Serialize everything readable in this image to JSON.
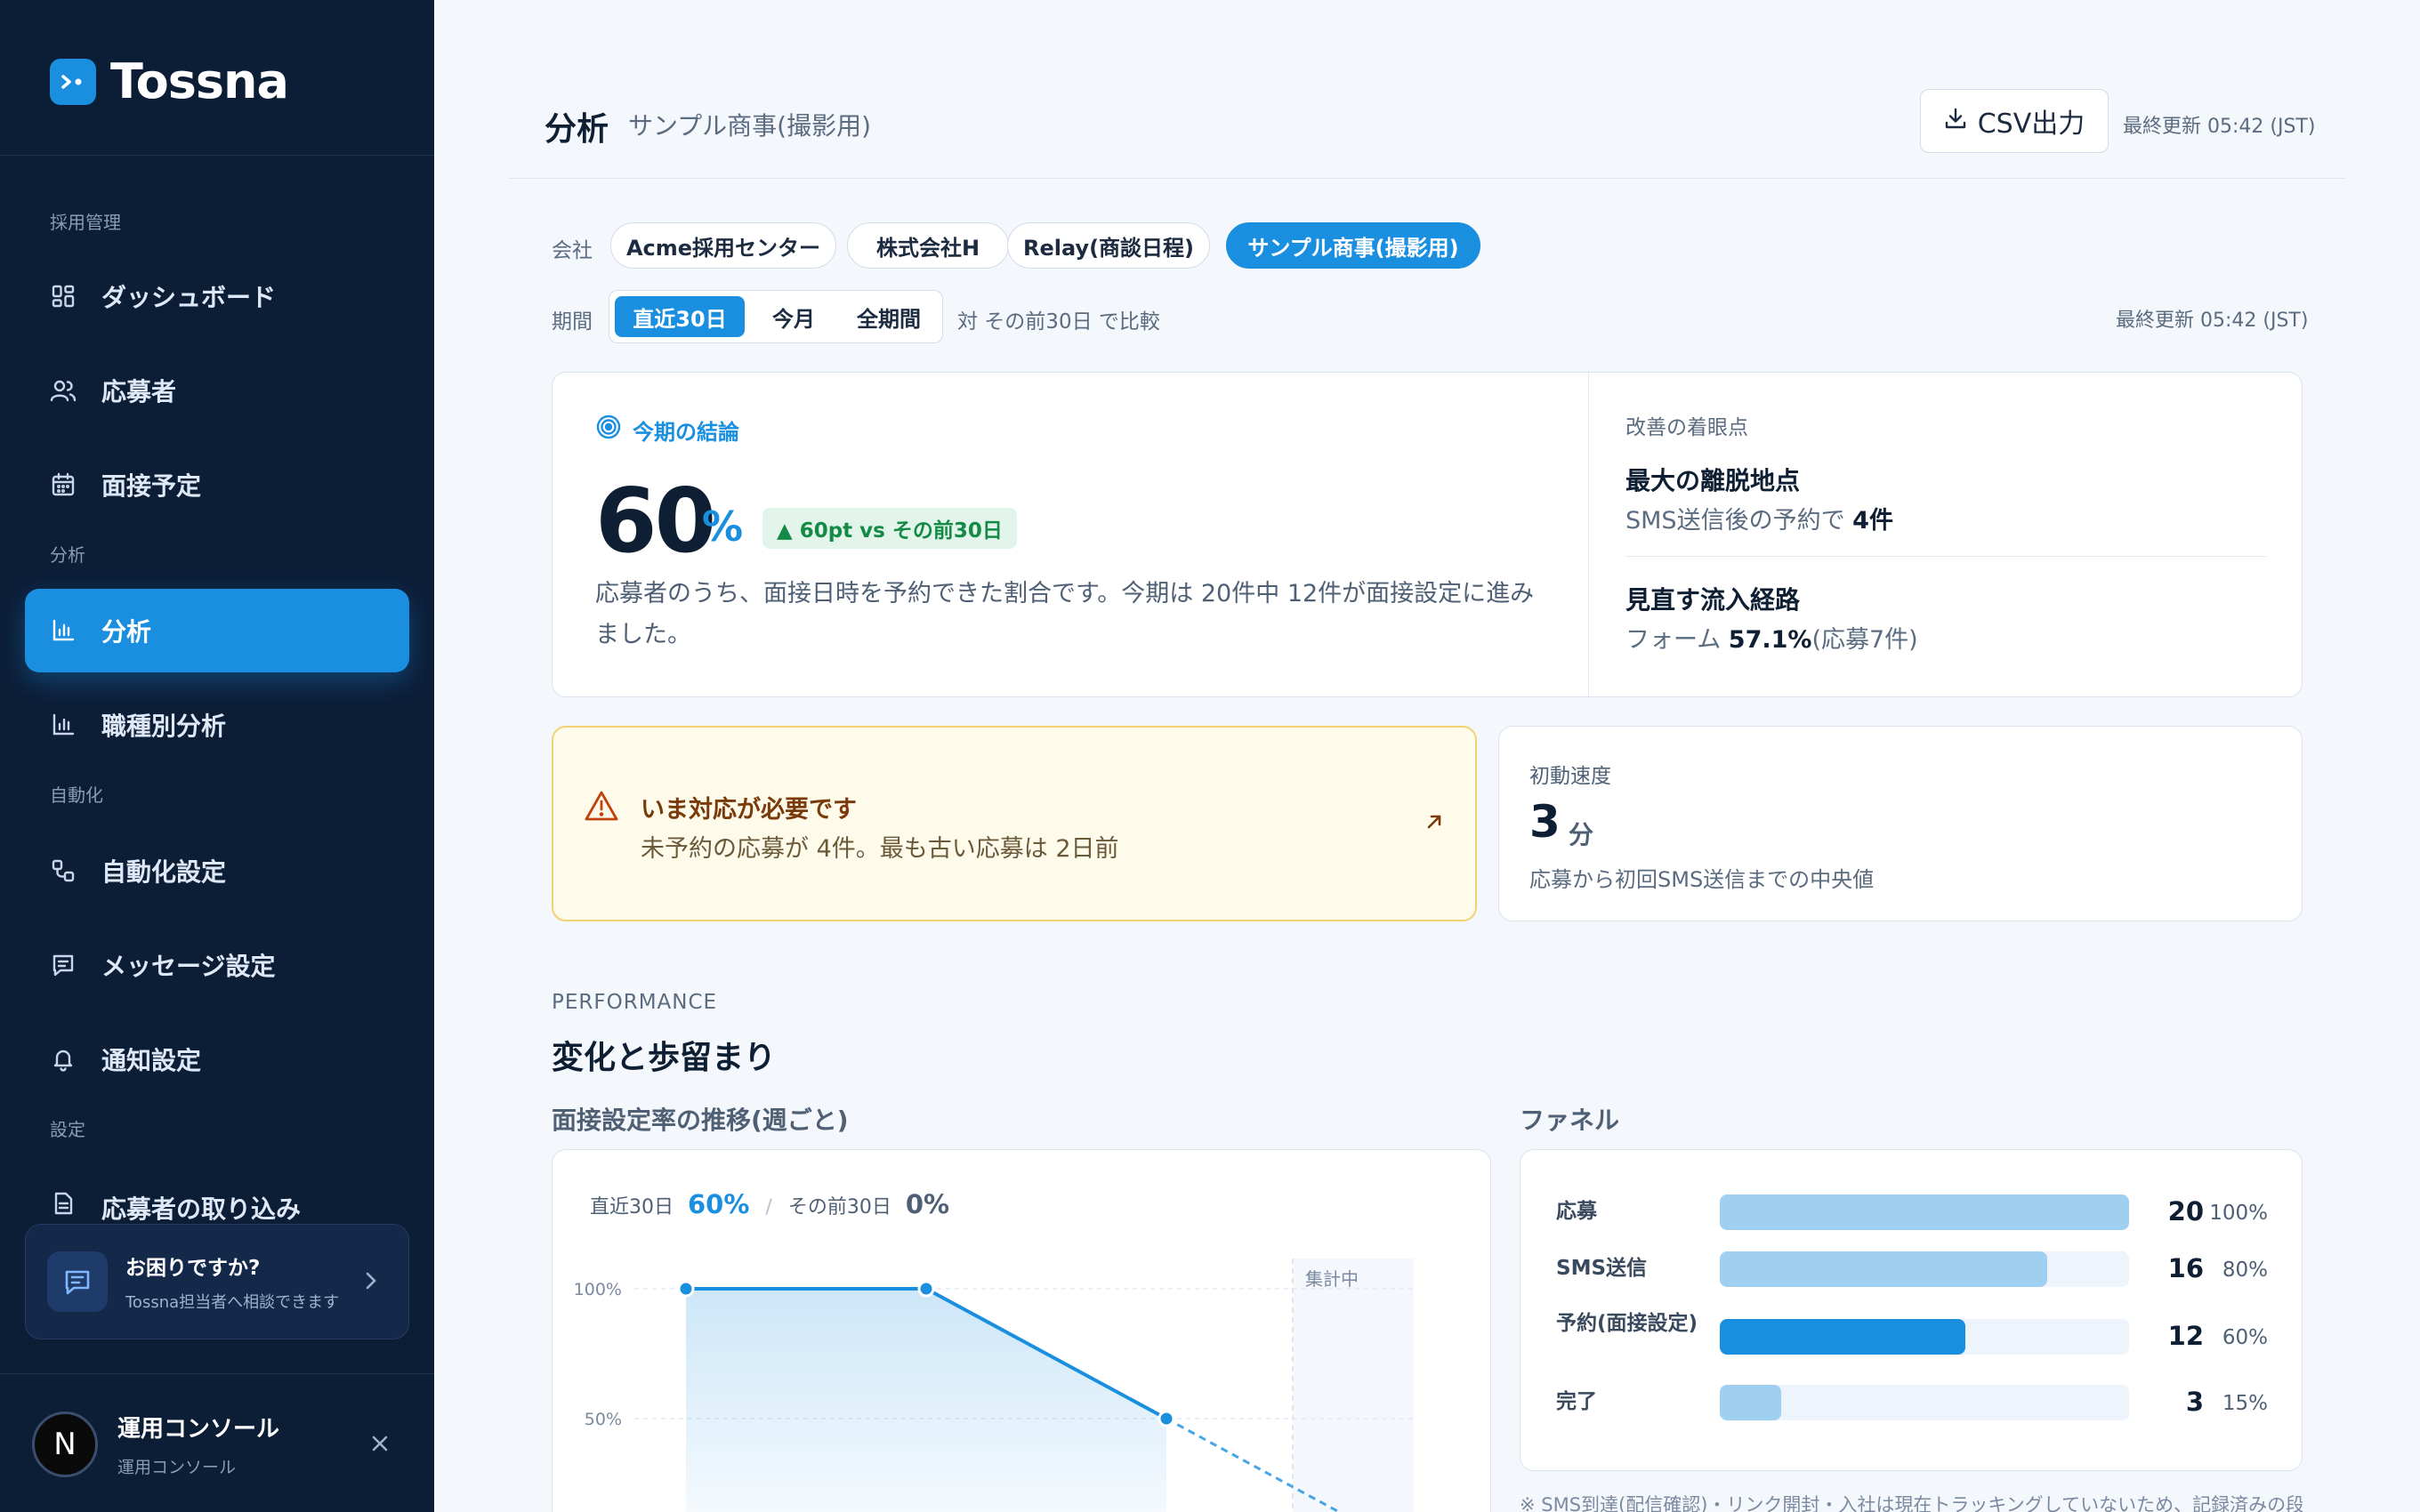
{
  "brand": {
    "name": "Tossna"
  },
  "sidebar": {
    "sections": [
      {
        "label": "採用管理",
        "items": [
          {
            "label": "ダッシュボード",
            "icon": "grid-icon"
          },
          {
            "label": "応募者",
            "icon": "users-icon"
          },
          {
            "label": "面接予定",
            "icon": "calendar-icon"
          }
        ]
      },
      {
        "label": "分析",
        "items": [
          {
            "label": "分析",
            "icon": "bar-chart-icon",
            "active": true
          },
          {
            "label": "職種別分析",
            "icon": "bar-chart-icon"
          }
        ]
      },
      {
        "label": "自動化",
        "items": [
          {
            "label": "自動化設定",
            "icon": "workflow-icon"
          },
          {
            "label": "メッセージ設定",
            "icon": "message-icon"
          },
          {
            "label": "通知設定",
            "icon": "bell-icon"
          }
        ]
      },
      {
        "label": "設定",
        "items": [
          {
            "label": "応募者の取り込み",
            "icon": "file-icon"
          }
        ]
      }
    ],
    "help": {
      "title": "お困りですか?",
      "subtitle": "Tossna担当者へ相談できます"
    },
    "user": {
      "initial": "N",
      "name": "運用コンソール",
      "role": "運用コンソール"
    }
  },
  "header": {
    "title": "分析",
    "subtitle": "サンプル商事(撮影用)",
    "csv_label": "CSV出力",
    "updated": "最終更新 05:42 (JST)"
  },
  "filters": {
    "company_label": "会社",
    "companies": [
      "Acme採用センター",
      "株式会社H",
      "Relay(商談日程)",
      "サンプル商事(撮影用)"
    ],
    "selected_company": "サンプル商事(撮影用)",
    "period_label": "期間",
    "periods": [
      "直近30日",
      "今月",
      "全期間"
    ],
    "selected_period": "直近30日",
    "compare_text": "対 その前30日 で比較",
    "updated": "最終更新 05:42 (JST)"
  },
  "kpi": {
    "tag": "今期の結論",
    "value": "60",
    "unit": "%",
    "delta": "▲ 60pt vs その前30日",
    "description": "応募者のうち、面接日時を予約できた割合です。今期は 20件中 12件が面接設定に進みました。",
    "focus_title": "改善の着眼点",
    "focus1_title": "最大の離脱地点",
    "focus1_text": "SMS送信後の予約で",
    "focus1_value": "4件",
    "focus2_title": "見直す流入経路",
    "focus2_text": "フォーム",
    "focus2_value": "57.1%",
    "focus2_suffix": "(応募7件)"
  },
  "alert": {
    "title": "いま対応が必要です",
    "description": "未予約の応募が 4件。最も古い応募は 2日前"
  },
  "speed": {
    "title": "初動速度",
    "value": "3",
    "unit": "分",
    "description": "応募から初回SMS送信までの中央値"
  },
  "performance": {
    "eyebrow": "PERFORMANCE",
    "title": "変化と歩留まり",
    "trend_title": "面接設定率の推移(週ごと)",
    "funnel_title": "ファネル"
  },
  "chart_data": {
    "type": "line",
    "title": "面接設定率の推移(週ごと)",
    "summary": {
      "current_label": "直近30日",
      "current_value": "60%",
      "previous_label": "その前30日",
      "previous_value": "0%"
    },
    "y_ticks": [
      "100%",
      "50%"
    ],
    "ylim": [
      0,
      100
    ],
    "series": [
      {
        "values": [
          100,
          100,
          50,
          0
        ],
        "partial_from_index": 2
      }
    ],
    "in_progress_label": "集計中",
    "colors": {
      "line": "#1a8fe0"
    }
  },
  "funnel": {
    "rows": [
      {
        "label": "応募",
        "count": "20",
        "pct": "100%",
        "fraction": 1.0,
        "color": "#9fd0f2"
      },
      {
        "label": "SMS送信",
        "count": "16",
        "pct": "80%",
        "fraction": 0.8,
        "color": "#9fd0f2"
      },
      {
        "label": "予約(面接設定)",
        "count": "12",
        "pct": "60%",
        "fraction": 0.6,
        "color": "#1a8fe0"
      },
      {
        "label": "完了",
        "count": "3",
        "pct": "15%",
        "fraction": 0.15,
        "color": "#9fd0f2"
      }
    ],
    "note": "※ SMS到達(配信確認)・リンク開封・入社は現在トラッキングしていないため、記録済みの段階"
  }
}
